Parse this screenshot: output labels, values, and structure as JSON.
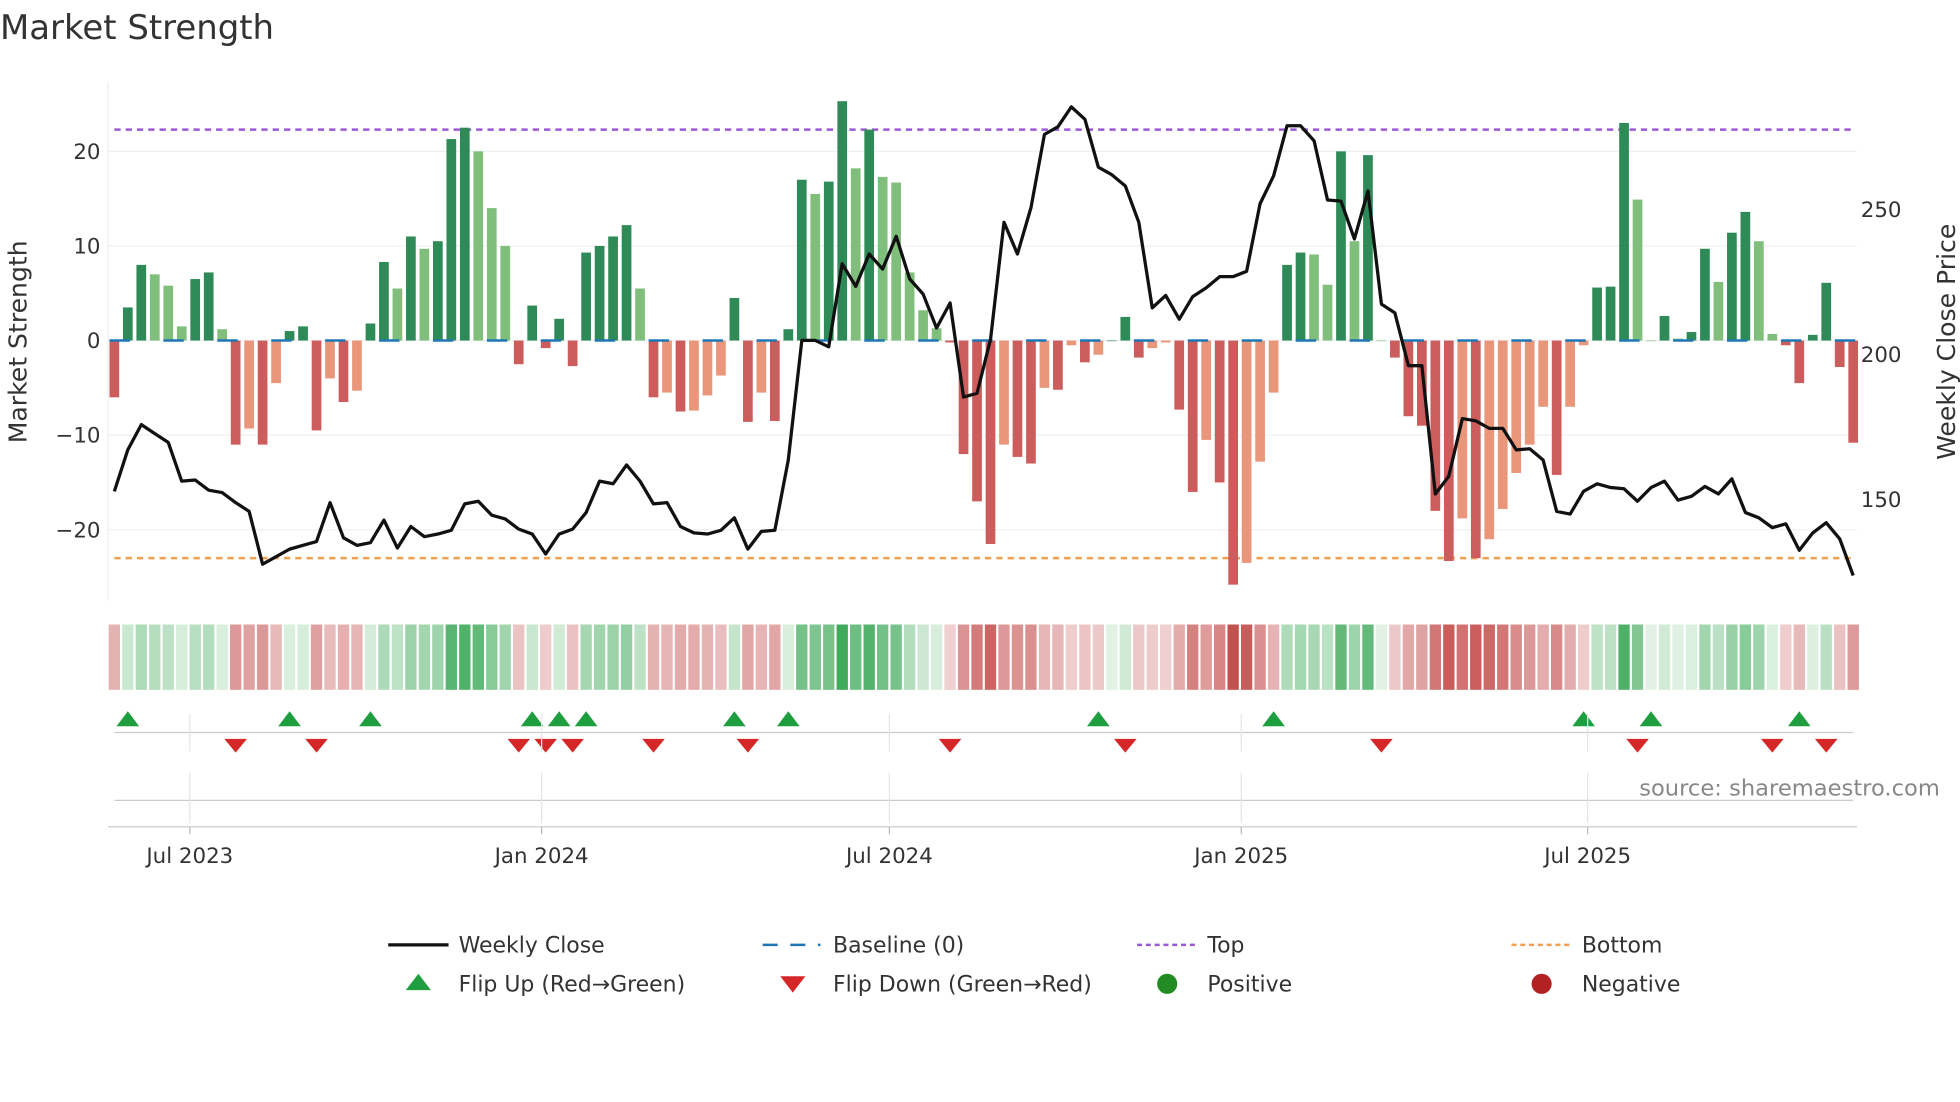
{
  "chart_data": {
    "type": "bar",
    "title": "Market Strength",
    "ylabel": "Market Strength",
    "y2label": "Weekly Close Price",
    "ylim": [
      -27,
      27
    ],
    "y2lim": [
      120,
      295
    ],
    "yticks": [
      {
        "v": 20,
        "label": "20"
      },
      {
        "v": 10,
        "label": "10"
      },
      {
        "v": 0,
        "label": "0"
      },
      {
        "v": -10,
        "label": "−10"
      },
      {
        "v": -20,
        "label": "−20"
      }
    ],
    "y2ticks": [
      {
        "v": 250,
        "label": "250"
      },
      {
        "v": 200,
        "label": "200"
      },
      {
        "v": 150,
        "label": "150"
      }
    ],
    "xticks": [
      {
        "week": 5.6,
        "label": "Jul 2023"
      },
      {
        "week": 31.7,
        "label": "Jan 2024"
      },
      {
        "week": 57.5,
        "label": "Jul 2024"
      },
      {
        "week": 83.6,
        "label": "Jan 2025"
      },
      {
        "week": 109.3,
        "label": "Jul 2025"
      }
    ],
    "top_level": 22.3,
    "bottom_level": -23,
    "baseline": 0,
    "strength": [
      -6,
      3.5,
      8,
      7,
      5.8,
      1.5,
      6.5,
      7.2,
      1.2,
      -11,
      -9.3,
      -11,
      -4.5,
      1,
      1.5,
      -9.5,
      -4,
      -6.5,
      -5.3,
      1.8,
      8.3,
      5.5,
      11,
      9.7,
      10.5,
      21.3,
      22.5,
      20,
      14,
      10,
      -2.5,
      3.7,
      -0.8,
      2.3,
      -2.7,
      9.3,
      10,
      11,
      12.2,
      5.5,
      -6,
      -5.5,
      -7.5,
      -7.4,
      -5.8,
      -3.7,
      4.5,
      -8.6,
      -5.5,
      -8.5,
      1.2,
      17,
      15.5,
      16.8,
      25.3,
      18.2,
      22.3,
      17.3,
      16.7,
      7.2,
      3.2,
      1.3,
      -0.2,
      -12,
      -17,
      -21.5,
      -11,
      -12.3,
      -13,
      -5,
      -5.2,
      -0.5,
      -2.3,
      -1.5,
      0,
      2.5,
      -1.8,
      -0.8,
      -0.2,
      -7.3,
      -16,
      -10.5,
      -15,
      -25.8,
      -23.5,
      -12.8,
      -5.5,
      8,
      9.3,
      9.1,
      5.9,
      20,
      10.5,
      19.6,
      0,
      -1.8,
      -8,
      -9,
      -18,
      -23.3,
      -18.8,
      -23,
      -21,
      -17.8,
      -14,
      -11,
      -7,
      -14.2,
      -7,
      -0.5,
      5.6,
      5.7,
      23,
      14.9,
      0,
      2.6,
      0.2,
      0.9,
      9.7,
      6.2,
      11.4,
      13.6,
      10.5,
      0.7,
      -0.5,
      -4.5,
      0.6,
      6.1,
      -2.8,
      -10.8
    ],
    "weekly_close": [
      152.8,
      167.1,
      175.8,
      172.7,
      169.7,
      156.3,
      156.7,
      153.2,
      152.4,
      148.9,
      145.9,
      127.7,
      130.3,
      132.9,
      134.2,
      135.5,
      148.9,
      136.8,
      134.2,
      135.1,
      142.9,
      133.3,
      140.7,
      137.2,
      138.1,
      139.4,
      148.5,
      149.4,
      144.6,
      143.3,
      139.8,
      138.1,
      131.2,
      138.1,
      139.8,
      145.5,
      156.3,
      155.4,
      161.9,
      156.3,
      148.5,
      148.9,
      140.7,
      138.5,
      138.1,
      139.4,
      143.7,
      132.9,
      139.0,
      139.4,
      163.6,
      204.8,
      204.8,
      202.6,
      231.2,
      223.4,
      234.6,
      229.4,
      240.7,
      226.0,
      220.8,
      209.1,
      217.7,
      185.3,
      186.6,
      205.2,
      245.5,
      234.6,
      250.6,
      275.8,
      278.4,
      285.3,
      281.0,
      264.5,
      261.9,
      258.0,
      245.5,
      216.0,
      220.3,
      212.1,
      219.9,
      222.9,
      226.8,
      226.8,
      228.6,
      251.9,
      261.5,
      278.8,
      278.8,
      273.6,
      253.2,
      252.8,
      239.8,
      256.3,
      217.3,
      214.3,
      196.1,
      196.1,
      151.9,
      158.0,
      177.9,
      177.1,
      174.5,
      174.5,
      167.1,
      167.5,
      163.6,
      145.9,
      145.0,
      152.8,
      155.4,
      154.1,
      153.7,
      149.4,
      154.1,
      156.3,
      149.8,
      151.1,
      154.5,
      151.9,
      157.1,
      145.5,
      143.7,
      140.3,
      141.6,
      132.5,
      138.5,
      142.0,
      136.4,
      123.8
    ],
    "flip_up_weeks": [
      1,
      13,
      19,
      31,
      33,
      35,
      46,
      50,
      73,
      86,
      109,
      114,
      125
    ],
    "flip_down_weeks": [
      9,
      15,
      30,
      32,
      34,
      40,
      47,
      62,
      75,
      94,
      113,
      123,
      127
    ],
    "legend": {
      "placement": "bottom",
      "entries": [
        {
          "key": "close",
          "label": "Weekly Close"
        },
        {
          "key": "baseline",
          "label": "Baseline (0)"
        },
        {
          "key": "top",
          "label": "Top"
        },
        {
          "key": "bottom",
          "label": "Bottom"
        },
        {
          "key": "flip_up",
          "label": "Flip Up (Red→Green)"
        },
        {
          "key": "flip_down",
          "label": "Flip Down (Green→Red)"
        },
        {
          "key": "positive",
          "label": "Positive"
        },
        {
          "key": "negative",
          "label": "Negative"
        }
      ]
    },
    "source": "source: sharemaestro.com"
  },
  "colors": {
    "pos_strong": "#2e8b57",
    "pos_weak": "#7fbf7b",
    "neg_strong": "#cd5c5c",
    "neg_weak": "#e9967a",
    "baseline": "#1f77b4",
    "top": "#9b59d6",
    "bottom": "#f0a050",
    "close": "#111111",
    "flip_up": "#1e9e3e",
    "flip_down": "#d62728",
    "positive": "#228b22",
    "negative": "#b22222"
  }
}
